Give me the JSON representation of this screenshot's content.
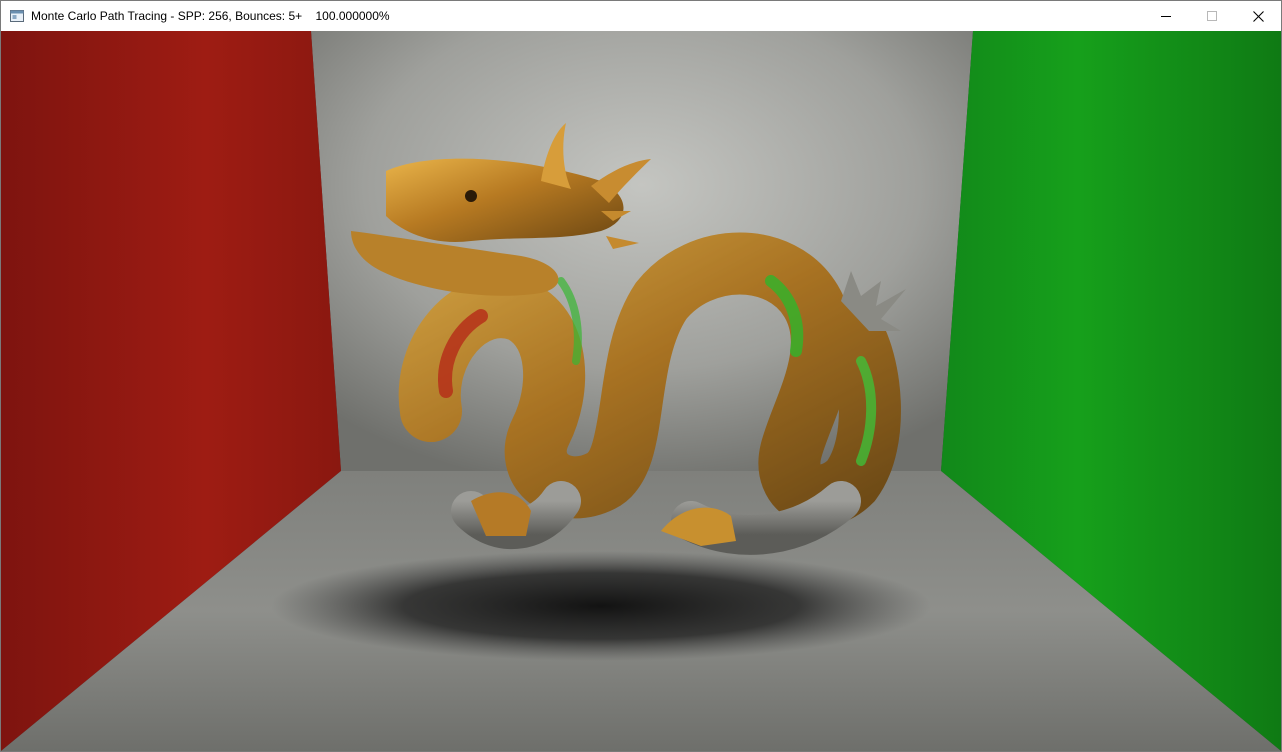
{
  "window": {
    "title": "Monte Carlo Path Tracing - SPP: 256, Bounces: 5+    100.000000%",
    "icons": {
      "app": "window-app-icon",
      "minimize": "minimize-icon",
      "maximize": "maximize-icon",
      "close": "close-icon"
    }
  },
  "render": {
    "scene": "cornell-box",
    "colors": {
      "left_wall": "#9c1a12",
      "right_wall": "#139a18",
      "back_wall": "#a9aaa6",
      "floor": "#8d8e8a",
      "ceiling": "#c9c9c7",
      "object_gold": "#c98b2a",
      "object_silver": "#8c8c88"
    }
  }
}
